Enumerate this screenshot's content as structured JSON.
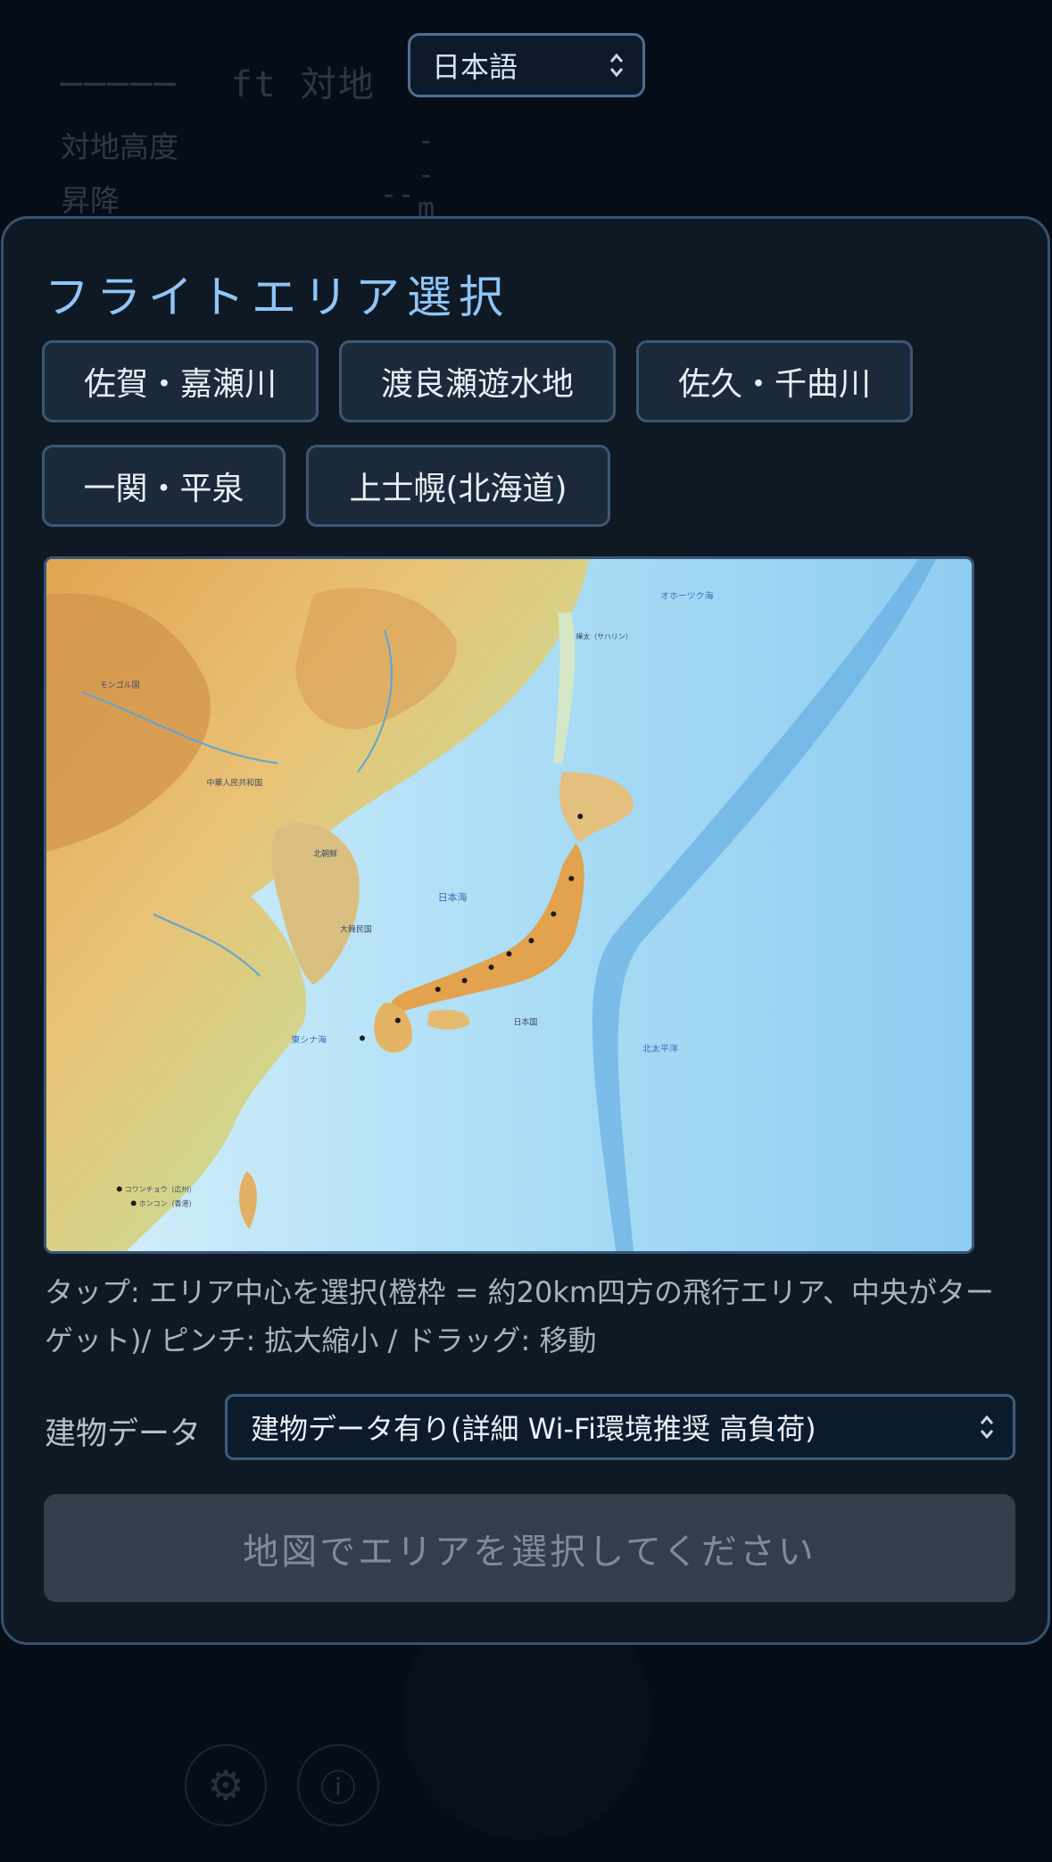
{
  "hud": {
    "altitude_dashes": "─────",
    "altitude_unit": "ft 対地",
    "agl_label": "対地高度",
    "agl_value": "-- m",
    "vs_label": "昇降",
    "vs_value": "-- m/s"
  },
  "language_select": {
    "value": "日本語"
  },
  "modal": {
    "title": "フライトエリア選択",
    "area_buttons": [
      {
        "label": "佐賀・嘉瀬川"
      },
      {
        "label": "渡良瀬遊水地"
      },
      {
        "label": "佐久・千曲川"
      },
      {
        "label": "一関・平泉"
      },
      {
        "label": "上士幌(北海道)"
      }
    ],
    "map": {
      "labels": {
        "okhotsk": "オホーツク海",
        "sea_of_japan": "日本海",
        "pacific": "北太平洋",
        "east_china_sea": "東シナ海",
        "mongolia": "モンゴル国",
        "china": "中華人民共和国",
        "north_korea": "北朝鮮",
        "south_korea": "大韓民国",
        "japan": "日本国",
        "sakhalin": "樺太（サハリン）",
        "hong_kong": "ホンコン（香港）",
        "guangzhou": "コワンチョウ（広州）"
      }
    },
    "help_text": "タップ: エリア中心を選択(橙枠 = 約20km四方の飛行エリア、中央がターゲット)/ ピンチ: 拡大縮小 / ドラッグ: 移動",
    "building_label": "建物データ",
    "building_select_value": "建物データ有り(詳細 Wi-Fi環境推奨 高負荷)",
    "confirm_button": "地図でエリアを選択してください"
  },
  "bottom": {
    "settings_icon": "gear-icon",
    "info_icon": "info-icon"
  },
  "colors": {
    "accent": "#8ec6f8",
    "modal_bg": "#0f1924",
    "page_bg": "#070d16"
  }
}
